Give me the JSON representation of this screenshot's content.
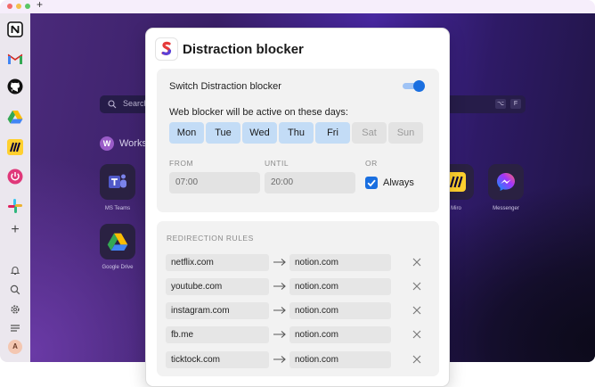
{
  "titlebar": {
    "dots": [
      "#f26b6b",
      "#f3c04d",
      "#5bc666"
    ],
    "new_tab_label": "+"
  },
  "sidebar": {
    "apps": [
      "notion-icon",
      "gmail-icon",
      "github-icon",
      "google-drive-icon",
      "miro-icon",
      "power-icon",
      "slack-icon",
      "plus-icon"
    ],
    "add_label": "+",
    "bottom": [
      "bell-icon",
      "search-icon",
      "settings-icon",
      "list-icon"
    ],
    "avatar_initial": "A"
  },
  "desktop": {
    "search_placeholder": "Search",
    "shortcut_keys": [
      "⌥",
      "F"
    ],
    "workspace_initial": "W",
    "workspace_label": "Works",
    "apps": [
      {
        "label": "MS Teams",
        "icon": "teams-icon"
      },
      {
        "label": "",
        "icon": "app-icon"
      },
      {
        "label": "Miro",
        "icon": "miro-icon"
      },
      {
        "label": "Messenger",
        "icon": "messenger-icon"
      },
      {
        "label": "Google Drive",
        "icon": "google-drive-icon"
      }
    ]
  },
  "modal": {
    "title": "Distraction blocker",
    "switch_label": "Switch Distraction blocker",
    "switch_on": true,
    "days_label": "Web blocker will be active on these days:",
    "days": [
      {
        "label": "Mon",
        "active": true
      },
      {
        "label": "Tue",
        "active": true
      },
      {
        "label": "Wed",
        "active": true
      },
      {
        "label": "Thu",
        "active": true
      },
      {
        "label": "Fri",
        "active": true
      },
      {
        "label": "Sat",
        "active": false
      },
      {
        "label": "Sun",
        "active": false
      }
    ],
    "from_label": "FROM",
    "until_label": "UNTIL",
    "or_label": "OR",
    "from_value": "07:00",
    "until_value": "20:00",
    "always_label": "Always",
    "always_checked": true,
    "rules_header": "REDIRECTION RULES",
    "rules": [
      {
        "from": "netflix.com",
        "to": "notion.com"
      },
      {
        "from": "youtube.com",
        "to": "notion.com"
      },
      {
        "from": "instagram.com",
        "to": "notion.com"
      },
      {
        "from": "fb.me",
        "to": "notion.com"
      },
      {
        "from": "ticktock.com",
        "to": "notion.com"
      }
    ]
  },
  "colors": {
    "accent": "#1a6fe0",
    "day_active": "#c3dcf6",
    "day_inactive": "#e3e3e3"
  }
}
